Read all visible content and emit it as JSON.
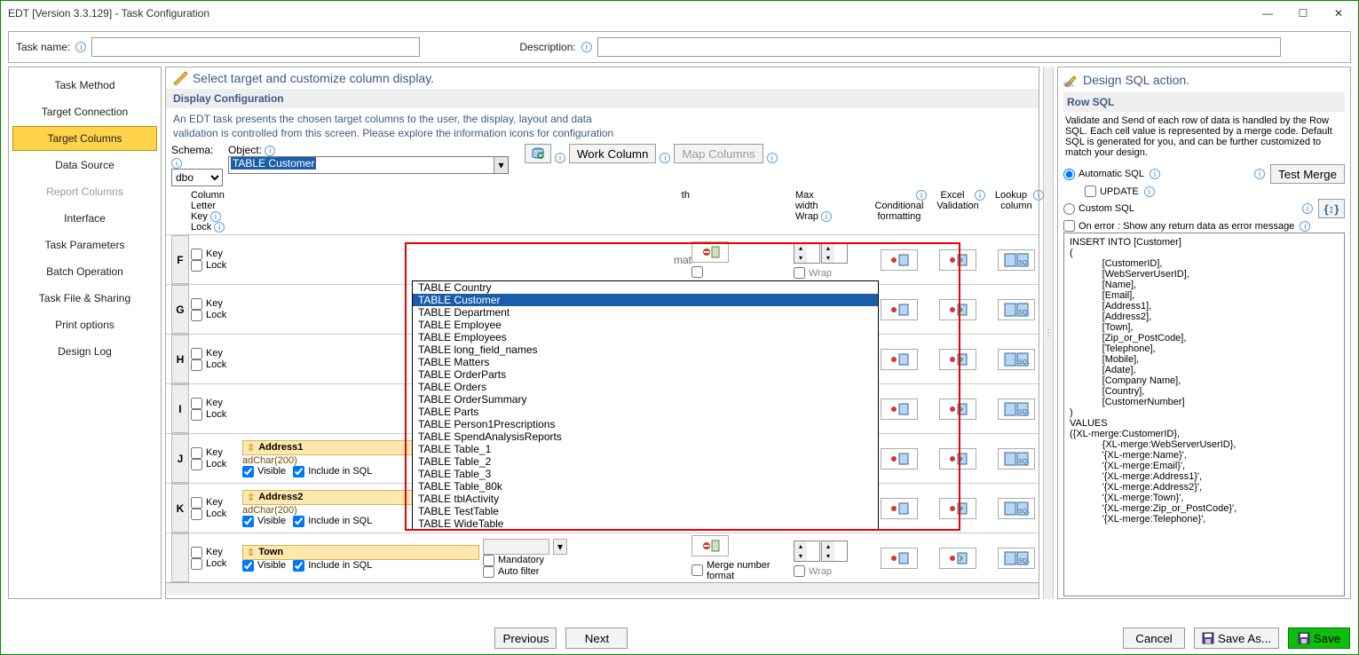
{
  "window": {
    "title": "EDT [Version 3.3.129] - Task Configuration"
  },
  "header": {
    "task_name_label": "Task name:",
    "task_name_value": "",
    "description_label": "Description:",
    "description_value": ""
  },
  "sidebar": {
    "items": [
      {
        "label": "Task Method",
        "state": "normal"
      },
      {
        "label": "Target Connection",
        "state": "normal"
      },
      {
        "label": "Target Columns",
        "state": "active"
      },
      {
        "label": "Data Source",
        "state": "normal"
      },
      {
        "label": "Report Columns",
        "state": "disabled"
      },
      {
        "label": "Interface",
        "state": "normal"
      },
      {
        "label": "Task Parameters",
        "state": "normal"
      },
      {
        "label": "Batch Operation",
        "state": "normal"
      },
      {
        "label": "Task File & Sharing",
        "state": "normal"
      },
      {
        "label": "Print options",
        "state": "normal"
      },
      {
        "label": "Design Log",
        "state": "normal"
      }
    ]
  },
  "center": {
    "heading": "Select target and customize column display.",
    "section": "Display Configuration",
    "hint1": "An EDT task presents the chosen target columns to the user, the display, layout and data",
    "hint2": "validation is controlled from this screen.  Please explore the information icons for configuration",
    "schema_label": "Schema:",
    "schema_value": "dbo",
    "object_label": "Object:",
    "object_value": "TABLE Customer",
    "work_column_btn": "Work Column",
    "map_columns_btn": "Map Columns",
    "columns_head": {
      "letter": "Column Letter",
      "key": "Key",
      "lock": "Lock",
      "maxwidth1": "Max",
      "maxwidth2": "width",
      "wrap": "Wrap",
      "cond": "Conditional formatting",
      "excel": "Excel Validation",
      "lookup": "Lookup column"
    },
    "shared_row_labels": {
      "key": "Key",
      "lock": "Lock",
      "visible": "Visible",
      "include": "Include in SQL",
      "mandatory": "Mandatory",
      "auto_filter": "Auto filter",
      "merge_num": "Merge number format",
      "wrap": "Wrap"
    },
    "rows": [
      {
        "letter": "F"
      },
      {
        "letter": "G"
      },
      {
        "letter": "H"
      },
      {
        "letter": "I"
      },
      {
        "letter": "J",
        "field_name": "Address1",
        "field_type": "adChar(200)"
      },
      {
        "letter": "K",
        "field_name": "Address2",
        "field_type": "adChar(200)"
      },
      {
        "letter": "",
        "field_name": "Town"
      }
    ],
    "object_options": [
      "TABLE Country",
      "TABLE Customer",
      "TABLE Department",
      "TABLE Employee",
      "TABLE Employees",
      "TABLE long_field_names",
      "TABLE Matters",
      "TABLE OrderParts",
      "TABLE Orders",
      "TABLE OrderSummary",
      "TABLE Parts",
      "TABLE Person1Prescriptions",
      "TABLE SpendAnalysisReports",
      "TABLE Table_1",
      "TABLE Table_2",
      "TABLE Table_3",
      "TABLE Table_80k",
      "TABLE tblActivity",
      "TABLE TestTable",
      "TABLE WideTable"
    ],
    "object_selected_index": 1
  },
  "right": {
    "heading": "Design SQL action.",
    "row_sql": "Row SQL",
    "desc": "Validate and Send of each row of data is handled by the Row SQL.  Each cell value is represented by a merge code. Default SQL is generated for you, and can be further customized to match your design.",
    "auto_sql": "Automatic SQL",
    "update": "UPDATE",
    "custom_sql": "Custom SQL",
    "test_merge": "Test Merge",
    "on_error": "On error : Show any return data as error message",
    "sql_text": "INSERT INTO [Customer]\n(\n            [CustomerID],\n            [WebServerUserID],\n            [Name],\n            [Email],\n            [Address1],\n            [Address2],\n            [Town],\n            [Zip_or_PostCode],\n            [Telephone],\n            [Mobile],\n            [Adate],\n            [Company Name],\n            [Country],\n            [CustomerNumber]\n)\nVALUES\n({XL-merge:CustomerID},\n            {XL-merge:WebServerUserID},\n            '{XL-merge:Name}',\n            '{XL-merge:Email}',\n            '{XL-merge:Address1}',\n            '{XL-merge:Address2}',\n            '{XL-merge:Town}',\n            '{XL-merge:Zip_or_PostCode}',\n            '{XL-merge:Telephone}',"
  },
  "footer": {
    "previous": "Previous",
    "next": "Next",
    "cancel": "Cancel",
    "save_as": "Save As...",
    "save": "Save"
  }
}
